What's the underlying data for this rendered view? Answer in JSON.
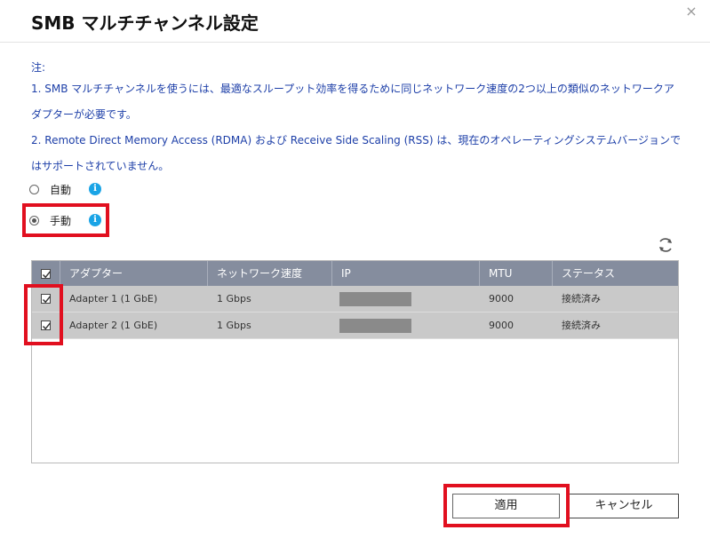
{
  "dialog": {
    "title": "SMB マルチチャンネル設定",
    "close_label": "×"
  },
  "notes": {
    "heading": "注:",
    "line1": "1. SMB マルチチャンネルを使うには、最適なスループット効率を得るために同じネットワーク速度の2つ以上の類似のネットワークアダプターが必要です。",
    "line2": "2. Remote Direct Memory Access (RDMA) および Receive Side Scaling (RSS) は、現在のオペレーティングシステムバージョンではサポートされていません。"
  },
  "modes": {
    "auto_label": "自動",
    "manual_label": "手動",
    "selected": "manual",
    "info_glyph": "i"
  },
  "table": {
    "columns": [
      "アダプター",
      "ネットワーク速度",
      "IP",
      "MTU",
      "ステータス"
    ],
    "rows": [
      {
        "checked": true,
        "adapter": "Adapter 1 (1 GbE)",
        "speed": "1 Gbps",
        "ip": "",
        "mtu": "9000",
        "status": "接続済み"
      },
      {
        "checked": true,
        "adapter": "Adapter 2 (1 GbE)",
        "speed": "1 Gbps",
        "ip": "",
        "mtu": "9000",
        "status": "接続済み"
      }
    ]
  },
  "buttons": {
    "apply_label": "適用",
    "cancel_label": "キャンセル"
  },
  "colors": {
    "highlight": "#e10f1f",
    "note_text": "#1d3fa8",
    "info_icon": "#1aa4e6",
    "table_header": "#858d9e",
    "row_background": "#c9c9c9"
  }
}
